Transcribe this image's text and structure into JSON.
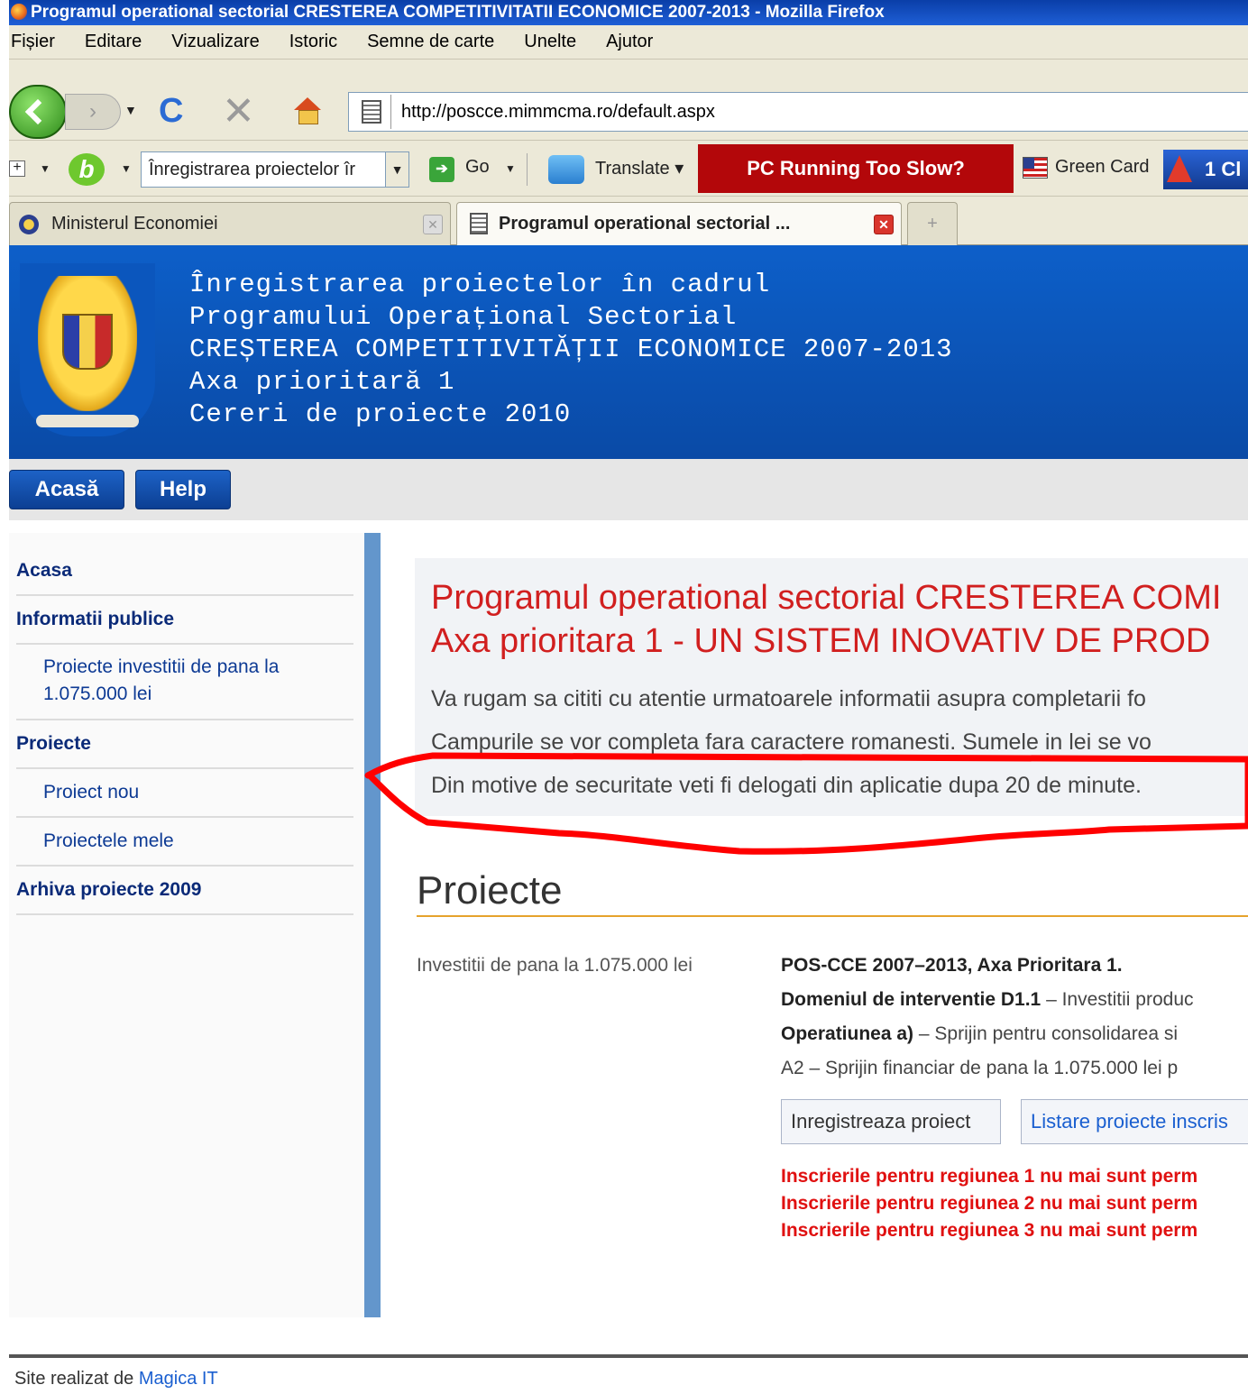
{
  "window": {
    "title": "Programul operational sectorial CRESTEREA COMPETITIVITATII ECONOMICE 2007-2013 - Mozilla Firefox"
  },
  "menu": [
    "Fișier",
    "Editare",
    "Vizualizare",
    "Istoric",
    "Semne de carte",
    "Unelte",
    "Ajutor"
  ],
  "navbar": {
    "url": "http://poscce.mimmcma.ro/default.aspx"
  },
  "searchbar": {
    "search_value": "Înregistrarea proiectelor îr",
    "go_label": "Go",
    "translate_label": "Translate",
    "ad_label": "PC Running Too Slow?",
    "greencard_label": "Green Card",
    "promo_label": "1 Cl"
  },
  "tabs": [
    {
      "label": "Ministerul Economiei",
      "active": false
    },
    {
      "label": "Programul operational sectorial ...",
      "active": true
    }
  ],
  "header": {
    "lines": [
      "Înregistrarea proiectelor în cadrul",
      "Programului Operațional Sectorial",
      "CREȘTEREA COMPETITIVITĂȚII ECONOMICE 2007-2013",
      "Axa prioritară 1",
      "Cereri de proiecte 2010"
    ]
  },
  "nav_buttons": {
    "home": "Acasă",
    "help": "Help"
  },
  "sidebar": {
    "items": [
      {
        "label": "Acasa",
        "type": "head"
      },
      {
        "label": "Informatii publice",
        "type": "head"
      },
      {
        "label": "Proiecte investitii de pana la 1.075.000 lei",
        "type": "sub"
      },
      {
        "label": "Proiecte",
        "type": "head"
      },
      {
        "label": "Proiect nou",
        "type": "sub"
      },
      {
        "label": "Proiectele mele",
        "type": "sub"
      },
      {
        "label": "Arhiva proiecte 2009",
        "type": "head"
      }
    ]
  },
  "main": {
    "title_line1": "Programul operational sectorial CRESTEREA COMI",
    "title_line2": "Axa prioritara 1 - UN SISTEM INOVATIV DE PROD",
    "info": [
      "Va rugam sa cititi cu atentie urmatoarele informatii asupra completarii fo",
      "Campurile se vor completa fara caractere romanesti. Sumele in lei se vo",
      "Din motive de securitate veti fi delogati din aplicatie dupa 20 de minute."
    ],
    "section_title": "Proiecte",
    "project": {
      "label": "Investitii de pana la 1.075.000 lei",
      "line1": "POS-CCE 2007–2013, Axa Prioritara 1.",
      "line2_bold": "Domeniul de interventie D1.1",
      "line2_rest": " – Investitii produc",
      "line3_bold": "Operatiunea a)",
      "line3_rest": " – Sprijin pentru consolidarea si",
      "line4": "A2 – Sprijin financiar de pana la 1.075.000 lei p",
      "btn_register": "Inregistreaza proiect",
      "btn_list": "Listare proiecte inscris"
    },
    "warnings": [
      "Inscrierile pentru regiunea 1 nu mai sunt perm",
      "Inscrierile pentru regiunea 2 nu mai sunt perm",
      "Inscrierile pentru regiunea 3 nu mai sunt perm"
    ]
  },
  "footer": {
    "prefix": "Site realizat de ",
    "link": "Magica IT"
  },
  "colors": {
    "header_blue": "#0d5fc9",
    "title_red": "#d11f1f",
    "warning_red": "#e01010",
    "annotation_red": "#ff0000",
    "sidebar_accent": "#6396cc"
  }
}
